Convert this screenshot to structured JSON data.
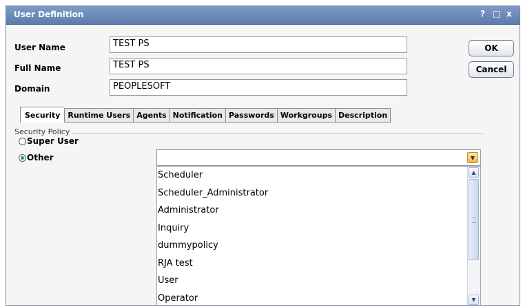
{
  "window": {
    "title": "User Definition",
    "help_label": "?",
    "restore_label": "□",
    "close_label": "x"
  },
  "fields": {
    "user_name_label": "User Name",
    "user_name_value": "TEST PS",
    "full_name_label": "Full Name",
    "full_name_value": "TEST PS",
    "domain_label": "Domain",
    "domain_value": "PEOPLESOFT"
  },
  "buttons": {
    "ok": "OK",
    "cancel": "Cancel"
  },
  "tabs": [
    "Security",
    "Runtime Users",
    "Agents",
    "Notification",
    "Passwords",
    "Workgroups",
    "Description"
  ],
  "active_tab": "Security",
  "security_policy": {
    "group_label": "Security Policy",
    "super_user_label": "Super User",
    "other_label": "Other",
    "selected": "Other",
    "combo_value": "",
    "options": [
      "Scheduler",
      "Scheduler_Administrator",
      "Administrator",
      "Inquiry",
      "dummypolicy",
      "RJA test",
      "User",
      "Operator"
    ]
  },
  "icons": {
    "combo_arrow": "chevron-down-icon",
    "scroll_up": "chevron-up-icon",
    "scroll_down": "chevron-down-icon"
  }
}
